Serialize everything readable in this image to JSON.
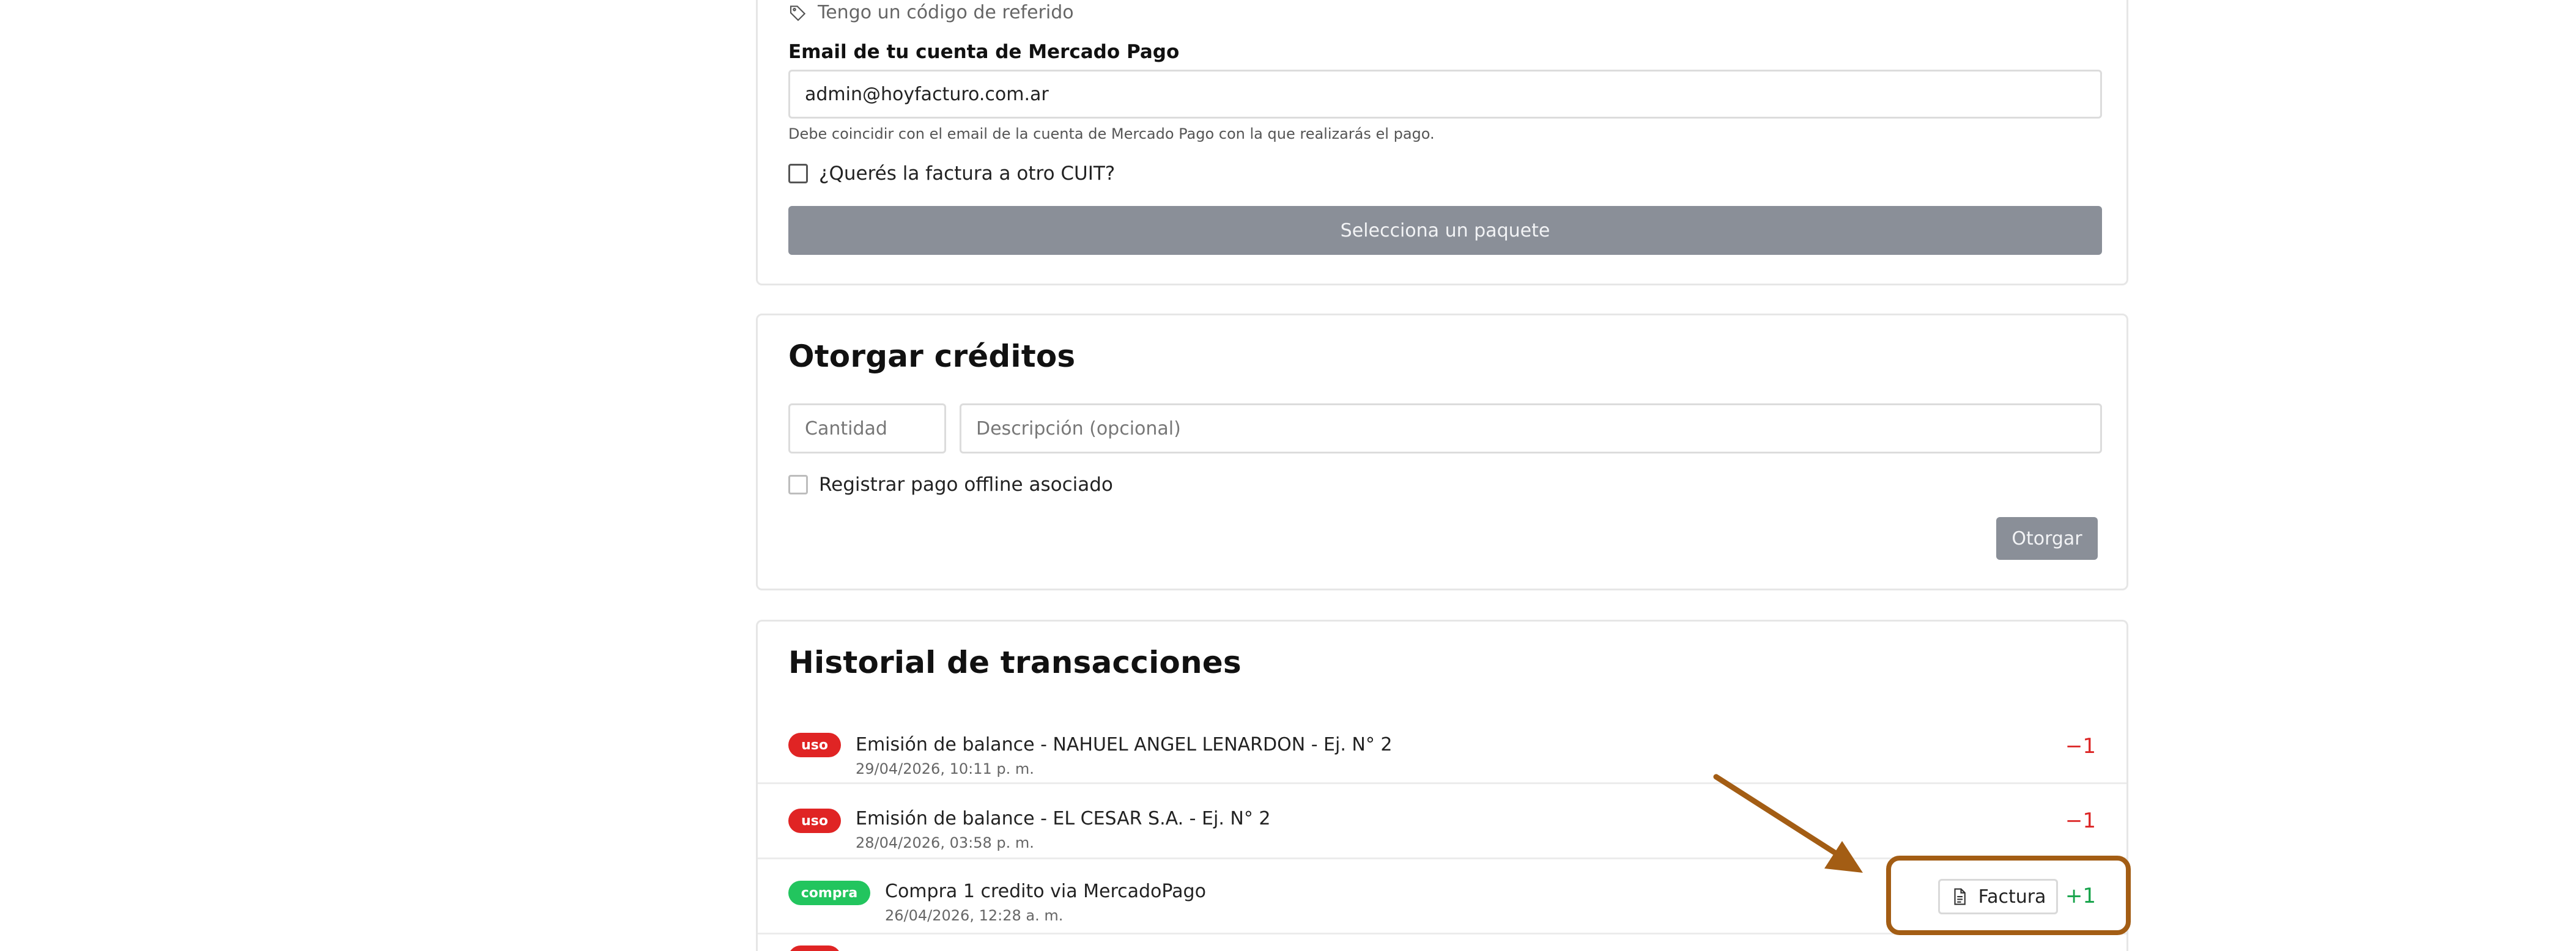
{
  "payment_form": {
    "referral_link": "Tengo un código de referido",
    "email_label": "Email de tu cuenta de Mercado Pago",
    "email_value": "admin@hoyfacturo.com.ar",
    "email_help": "Debe coincidir con el email de la cuenta de Mercado Pago con la que realizarás el pago.",
    "other_cuit_label": "¿Querés la factura a otro CUIT?",
    "submit_label": "Selecciona un paquete"
  },
  "grant_credits": {
    "title": "Otorgar créditos",
    "quantity_placeholder": "Cantidad",
    "description_placeholder": "Descripción (opcional)",
    "offline_label": "Registrar pago offline asociado",
    "submit_label": "Otorgar"
  },
  "history": {
    "title": "Historial de transacciones",
    "rows": [
      {
        "badge": "uso",
        "description": "Emisión de balance - NAHUEL ANGEL LENARDON - Ej. N° 2",
        "date": "29/04/2026, 10:11 p. m.",
        "amount": "−1"
      },
      {
        "badge": "uso",
        "description": "Emisión de balance - EL CESAR S.A. - Ej. N° 2",
        "date": "28/04/2026, 03:58 p. m.",
        "amount": "−1"
      },
      {
        "badge": "compra",
        "description": "Compra 1 credito via MercadoPago",
        "date": "26/04/2026, 12:28 a. m.",
        "amount": "+1",
        "invoice_label": "Factura"
      }
    ]
  },
  "colors": {
    "usage_badge": "#e02424",
    "purchase_badge": "#22c55e",
    "negative_amount": "#dc2626",
    "positive_amount": "#16a34a",
    "annotation": "#a35d14"
  }
}
